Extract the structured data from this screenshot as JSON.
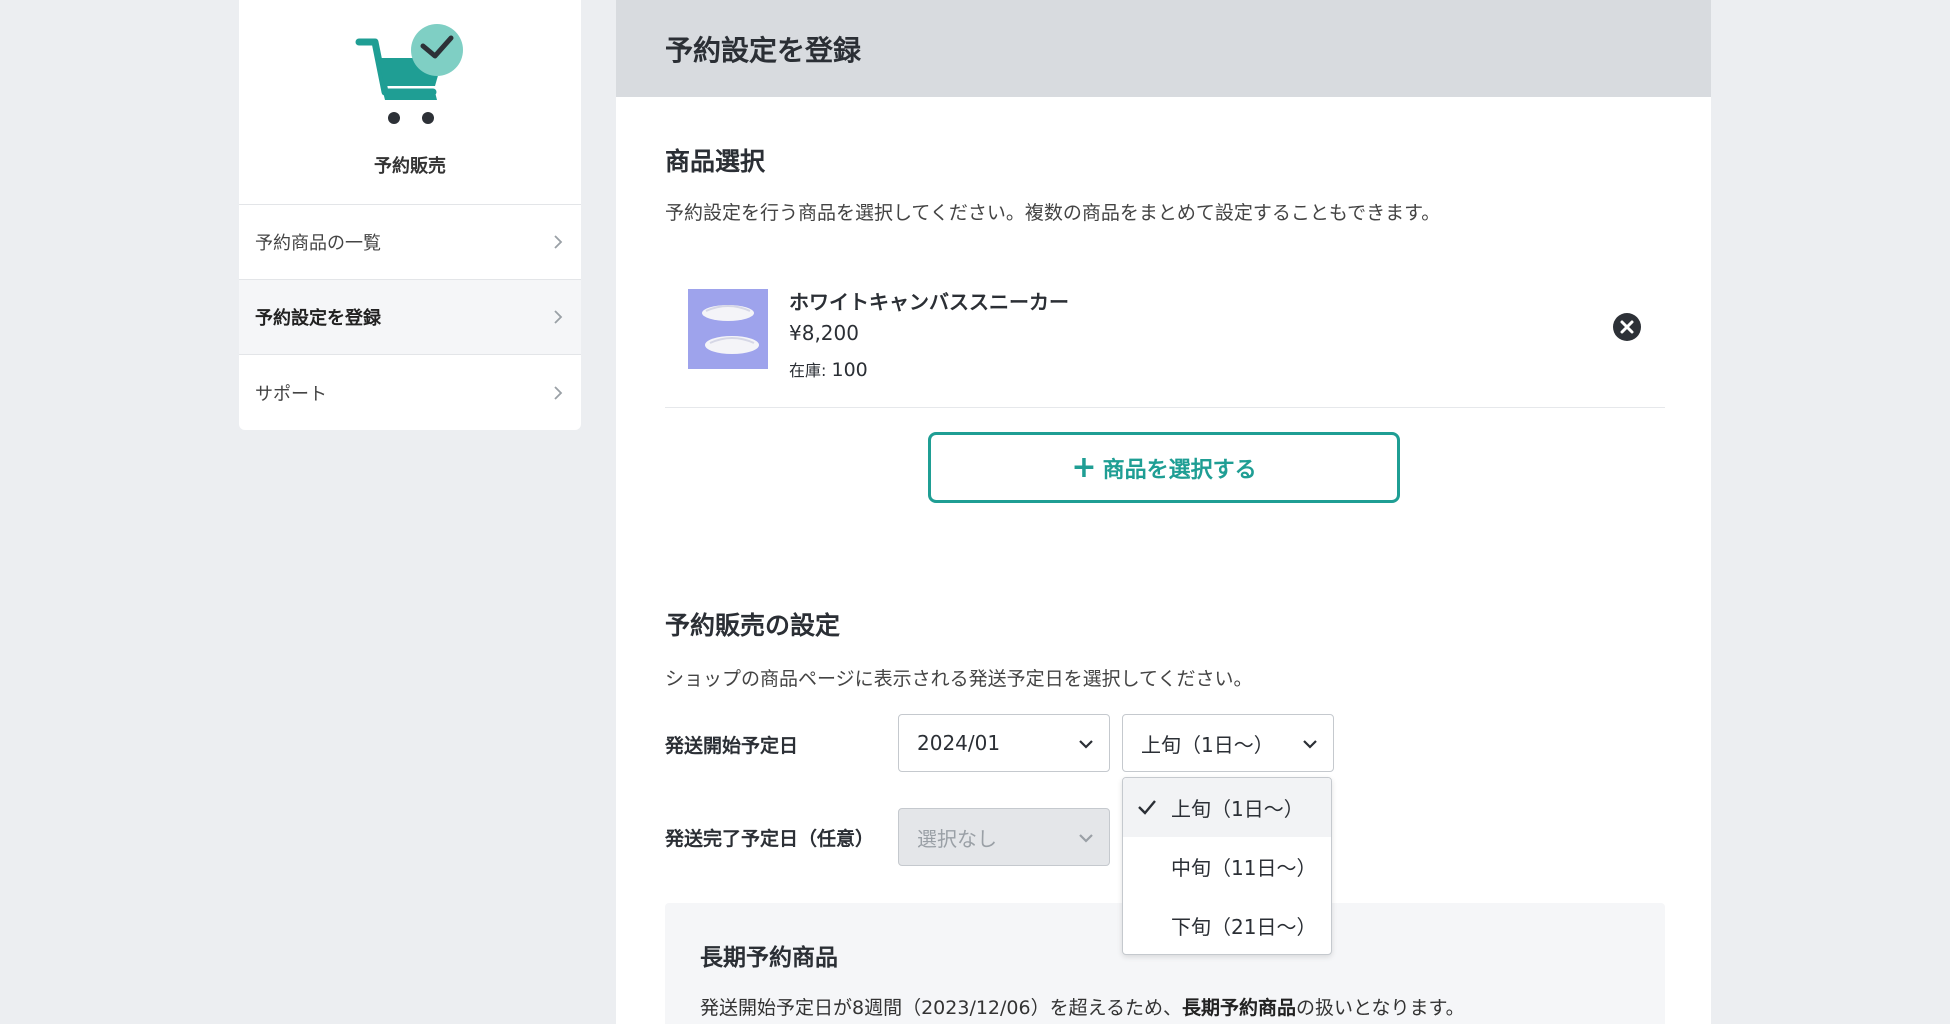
{
  "sidebar": {
    "app_name": "予約販売",
    "items": [
      {
        "label": "予約商品の一覧"
      },
      {
        "label": "予約設定を登録"
      },
      {
        "label": "サポート"
      }
    ]
  },
  "main": {
    "title": "予約設定を登録",
    "product_section": {
      "title": "商品選択",
      "description": "予約設定を行う商品を選択してください。複数の商品をまとめて設定することもできます。",
      "product": {
        "name": "ホワイトキャンバススニーカー",
        "price": "¥8,200",
        "stock_label": "在庫: ",
        "stock_value": "100"
      },
      "select_button": "商品を選択する"
    },
    "preorder_section": {
      "title": "予約販売の設定",
      "description": "ショップの商品ページに表示される発送予定日を選択してください。",
      "ship_start": {
        "label": "発送開始予定日",
        "month_value": "2024/01",
        "period_value": "上旬（1日〜）"
      },
      "ship_end": {
        "label": "発送完了予定日（任意）",
        "placeholder": "選択なし"
      },
      "period_options": [
        "上旬（1日〜）",
        "中旬（11日〜）",
        "下旬（21日〜）"
      ]
    },
    "notice": {
      "title": "長期予約商品",
      "text_before": "発送開始予定日が8週間（2023/12/06）を超えるため、",
      "text_bold": "長期予約商品",
      "text_after": "の扱いとなります。"
    }
  },
  "colors": {
    "accent": "#1f9e94",
    "header_bg": "#d8dbdf",
    "page_bg": "#eceef1"
  }
}
